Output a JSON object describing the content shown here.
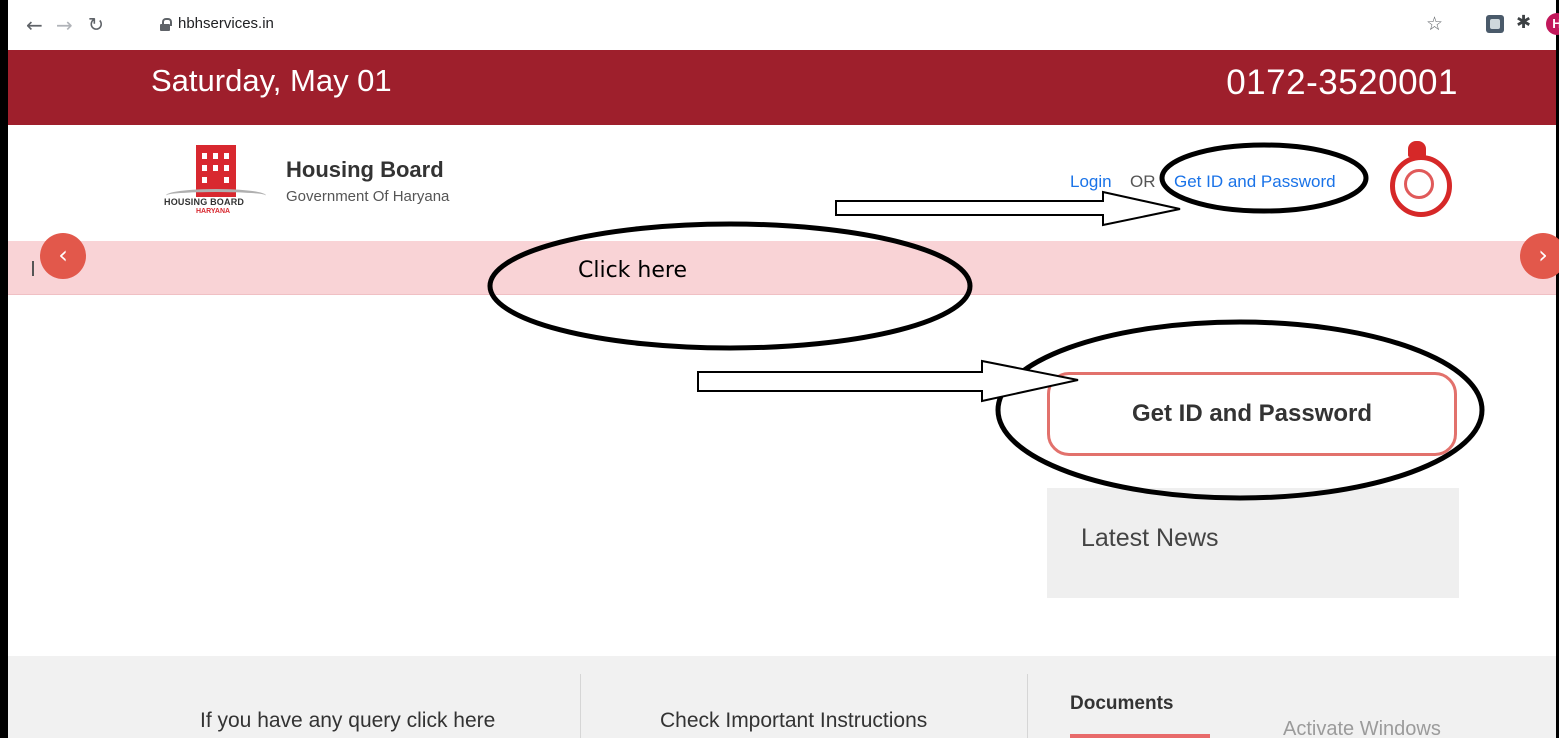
{
  "browser": {
    "url": "hbhservices.in",
    "avatar_letter": "H"
  },
  "topbar": {
    "date": "Saturday, May 01",
    "phone": "0172-3520001"
  },
  "header": {
    "logo_text": "HOUSING BOARD",
    "logo_subtext": "HARYANA",
    "title": "Housing Board",
    "subtitle": "Government Of Haryana",
    "login_label": "Login",
    "or_label": "OR",
    "get_id_link": "Get ID and Password"
  },
  "ticker": {
    "prev_label": "‹",
    "next_label": "›"
  },
  "main": {
    "get_id_button": "Get ID and Password",
    "news_title": "Latest News"
  },
  "footer": {
    "query_text": "If you have any query click here",
    "instructions_text": "Check Important Instructions",
    "documents_title": "Documents"
  },
  "overlay": {
    "activate_windows": "Activate Windows"
  },
  "annotations": {
    "callout_text": "Click here"
  },
  "colors": {
    "topbar": "#9e1f2c",
    "ticker": "#f9d3d6",
    "link": "#1a73e8",
    "button_border": "#e2716c",
    "nav_circle": "#e2584b"
  }
}
